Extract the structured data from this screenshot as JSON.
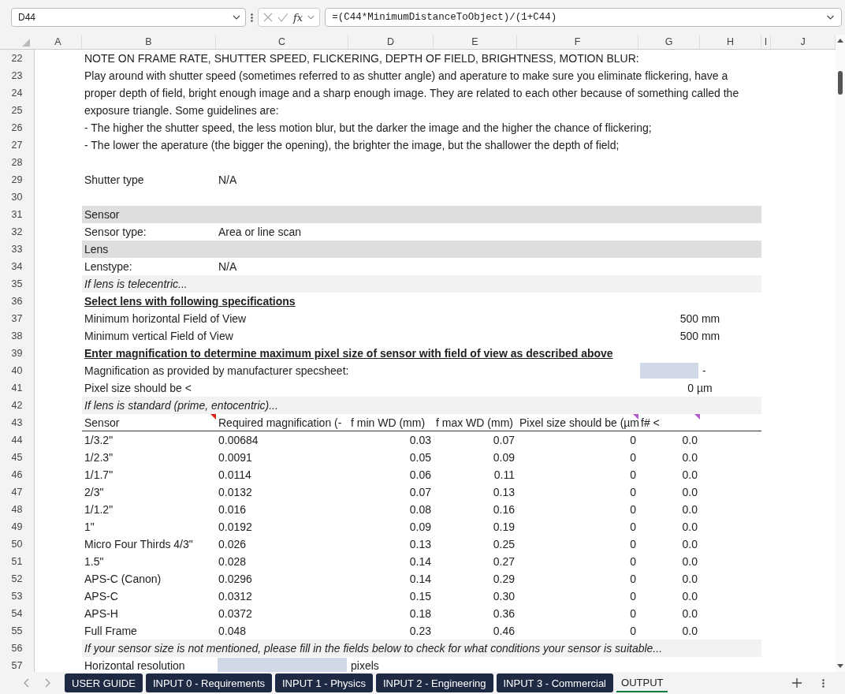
{
  "formula_bar": {
    "name_box": "D44",
    "fx": "fx",
    "formula": "=(C44*MinimumDistanceToObject)/(1+C44)"
  },
  "columns": [
    "A",
    "B",
    "C",
    "D",
    "E",
    "F",
    "G",
    "H",
    "I",
    "J"
  ],
  "rows": [
    {
      "number": "22",
      "kind": "text",
      "text": "NOTE ON FRAME RATE, SHUTTER SPEED, FLICKERING, DEPTH OF FIELD, BRIGHTNESS, MOTION BLUR:"
    },
    {
      "number": "23",
      "kind": "text",
      "text": "Play around with shutter speed (sometimes referred to as shutter angle) and aperature to make sure you eliminate flickering, have a"
    },
    {
      "number": "24",
      "kind": "text",
      "text": "proper depth of field, bright enough image and a sharp enough image. They are related to each other because of something called the"
    },
    {
      "number": "25",
      "kind": "text",
      "text": "exposure triangle. Some guidelines are:"
    },
    {
      "number": "26",
      "kind": "text",
      "text": "- The higher the shutter speed, the less motion blur, but the darker the image and the higher the chance of flickering;"
    },
    {
      "number": "27",
      "kind": "text",
      "text": "- The lower the aperature (the bigger the opening), the brighter the image, but the shallower the depth of field;"
    },
    {
      "number": "28",
      "kind": "blank"
    },
    {
      "number": "29",
      "kind": "field",
      "label": "Shutter type",
      "value": "N/A"
    },
    {
      "number": "30",
      "kind": "blank"
    },
    {
      "number": "31",
      "kind": "section",
      "text": "Sensor"
    },
    {
      "number": "32",
      "kind": "field",
      "label": "Sensor type:",
      "value": "Area or line scan"
    },
    {
      "number": "33",
      "kind": "section",
      "text": "Lens"
    },
    {
      "number": "34",
      "kind": "field",
      "label": "Lenstype:",
      "value": "N/A"
    },
    {
      "number": "35",
      "kind": "note",
      "text": "If lens is telecentric..."
    },
    {
      "number": "36",
      "kind": "heading",
      "text": "Select lens with following specifications"
    },
    {
      "number": "37",
      "kind": "spec",
      "label": "Minimum horizontal Field of View",
      "value": "500 mm"
    },
    {
      "number": "38",
      "kind": "spec",
      "label": "Minimum vertical Field of View",
      "value": "500 mm"
    },
    {
      "number": "39",
      "kind": "heading",
      "text": "Enter magnification to determine maximum pixel size of sensor with field of view as described above"
    },
    {
      "number": "40",
      "kind": "entry",
      "label": "Magnification as provided by manufacturer specsheet:",
      "unit": "-"
    },
    {
      "number": "41",
      "kind": "spec",
      "label": "Pixel size should be <",
      "value": "0 µm"
    },
    {
      "number": "42",
      "kind": "note",
      "text": "If lens is standard (prime, entocentric)..."
    },
    {
      "number": "43",
      "kind": "table_header",
      "columns": [
        {
          "label": "Sensor",
          "has_note": true,
          "has_comment": false
        },
        {
          "label": "Required magnification (-",
          "has_note": false,
          "has_comment": false
        },
        {
          "label": "f min WD (mm)",
          "has_note": false,
          "has_comment": false
        },
        {
          "label": "f max WD (mm)",
          "has_note": false,
          "has_comment": false
        },
        {
          "label": "Pixel size should be (µm",
          "has_note": false,
          "has_comment": true
        },
        {
          "label": "f# <",
          "has_note": false,
          "has_comment": true
        }
      ]
    },
    {
      "number": "44",
      "kind": "sensor",
      "sensor": "1/3.2\"",
      "magnification": "0.00684",
      "f_min_wd": "0.03",
      "f_max_wd": "0.07",
      "pixel_size": "0",
      "f_number": "0.0"
    },
    {
      "number": "45",
      "kind": "sensor",
      "sensor": "1/2.3\"",
      "magnification": "0.0091",
      "f_min_wd": "0.05",
      "f_max_wd": "0.09",
      "pixel_size": "0",
      "f_number": "0.0"
    },
    {
      "number": "46",
      "kind": "sensor",
      "sensor": "1/1.7\"",
      "magnification": "0.0114",
      "f_min_wd": "0.06",
      "f_max_wd": "0.11",
      "pixel_size": "0",
      "f_number": "0.0"
    },
    {
      "number": "47",
      "kind": "sensor",
      "sensor": "2/3\"",
      "magnification": "0.0132",
      "f_min_wd": "0.07",
      "f_max_wd": "0.13",
      "pixel_size": "0",
      "f_number": "0.0"
    },
    {
      "number": "48",
      "kind": "sensor",
      "sensor": "1/1.2\"",
      "magnification": "0.016",
      "f_min_wd": "0.08",
      "f_max_wd": "0.16",
      "pixel_size": "0",
      "f_number": "0.0"
    },
    {
      "number": "49",
      "kind": "sensor",
      "sensor": "1\"",
      "magnification": "0.0192",
      "f_min_wd": "0.09",
      "f_max_wd": "0.19",
      "pixel_size": "0",
      "f_number": "0.0"
    },
    {
      "number": "50",
      "kind": "sensor",
      "sensor": "Micro Four Thirds 4/3\"",
      "magnification": "0.026",
      "f_min_wd": "0.13",
      "f_max_wd": "0.25",
      "pixel_size": "0",
      "f_number": "0.0"
    },
    {
      "number": "51",
      "kind": "sensor",
      "sensor": "1.5\"",
      "magnification": "0.028",
      "f_min_wd": "0.14",
      "f_max_wd": "0.27",
      "pixel_size": "0",
      "f_number": "0.0"
    },
    {
      "number": "52",
      "kind": "sensor",
      "sensor": "APS-C (Canon)",
      "magnification": "0.0296",
      "f_min_wd": "0.14",
      "f_max_wd": "0.29",
      "pixel_size": "0",
      "f_number": "0.0"
    },
    {
      "number": "53",
      "kind": "sensor",
      "sensor": "APS-C",
      "magnification": "0.0312",
      "f_min_wd": "0.15",
      "f_max_wd": "0.30",
      "pixel_size": "0",
      "f_number": "0.0"
    },
    {
      "number": "54",
      "kind": "sensor",
      "sensor": "APS-H",
      "magnification": "0.0372",
      "f_min_wd": "0.18",
      "f_max_wd": "0.36",
      "pixel_size": "0",
      "f_number": "0.0"
    },
    {
      "number": "55",
      "kind": "sensor",
      "sensor": "Full Frame",
      "magnification": "0.048",
      "f_min_wd": "0.23",
      "f_max_wd": "0.46",
      "pixel_size": "0",
      "f_number": "0.0"
    },
    {
      "number": "56",
      "kind": "note",
      "text": "If your sensor size is not mentioned, please fill in the fields below to check for what conditions your sensor is suitable..."
    },
    {
      "number": "57",
      "kind": "resolution",
      "label": "Horizontal resolution",
      "unit": "pixels"
    }
  ],
  "sheet_tabs": [
    {
      "label": "USER GUIDE",
      "selected": false
    },
    {
      "label": "INPUT 0 - Requirements",
      "selected": false
    },
    {
      "label": "INPUT 1 - Physics",
      "selected": false
    },
    {
      "label": "INPUT 2 - Engineering",
      "selected": false
    },
    {
      "label": "INPUT 3 - Commercial",
      "selected": false
    },
    {
      "label": "OUTPUT",
      "selected": true
    }
  ]
}
